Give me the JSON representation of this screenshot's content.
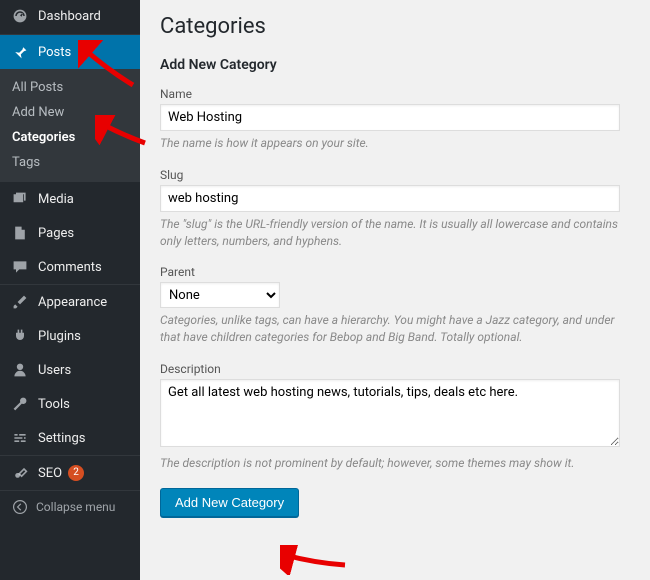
{
  "sidebar": {
    "dashboard": "Dashboard",
    "posts": "Posts",
    "submenu": {
      "all_posts": "All Posts",
      "add_new": "Add New",
      "categories": "Categories",
      "tags": "Tags"
    },
    "media": "Media",
    "pages": "Pages",
    "comments": "Comments",
    "appearance": "Appearance",
    "plugins": "Plugins",
    "users": "Users",
    "tools": "Tools",
    "settings": "Settings",
    "seo": "SEO",
    "seo_badge": "2",
    "collapse": "Collapse menu"
  },
  "page": {
    "title": "Categories",
    "section_title": "Add New Category",
    "name": {
      "label": "Name",
      "value": "Web Hosting",
      "help": "The name is how it appears on your site."
    },
    "slug": {
      "label": "Slug",
      "value": "web hosting",
      "help": "The \"slug\" is the URL-friendly version of the name. It is usually all lowercase and contains only letters, numbers, and hyphens."
    },
    "parent": {
      "label": "Parent",
      "selected": "None",
      "help": "Categories, unlike tags, can have a hierarchy. You might have a Jazz category, and under that have children categories for Bebop and Big Band. Totally optional."
    },
    "description": {
      "label": "Description",
      "value": "Get all latest web hosting news, tutorials, tips, deals etc here.",
      "help": "The description is not prominent by default; however, some themes may show it."
    },
    "submit": "Add New Category"
  }
}
